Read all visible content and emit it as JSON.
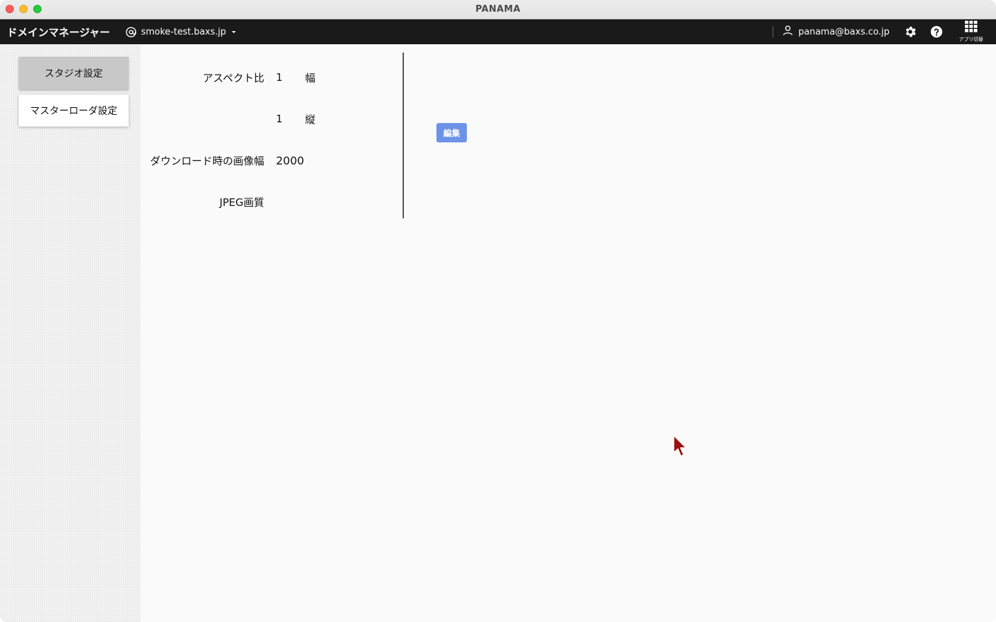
{
  "window": {
    "title": "PANAMA"
  },
  "header": {
    "app_title": "ドメインマネージャー",
    "domain": "smoke-test.baxs.jp",
    "user_email": "panama@baxs.co.jp",
    "apps_label": "アプリ切替"
  },
  "sidebar": {
    "items": [
      {
        "label": "スタジオ設定",
        "active": true
      },
      {
        "label": "マスターローダ設定",
        "active": false
      }
    ]
  },
  "settings": {
    "aspect_label": "アスペクト比",
    "aspect_width_value": "1",
    "aspect_width_unit": "幅",
    "aspect_height_value": "1",
    "aspect_height_unit": "縦",
    "download_width_label": "ダウンロード時の画像幅",
    "download_width_value": "2000",
    "jpeg_quality_label": "JPEG画質",
    "jpeg_quality_value": ""
  },
  "actions": {
    "edit_label": "編集"
  },
  "colors": {
    "header_bg": "#1a1a1a",
    "edit_button": "#6d93e8",
    "active_tab": "#c8c8c8"
  }
}
